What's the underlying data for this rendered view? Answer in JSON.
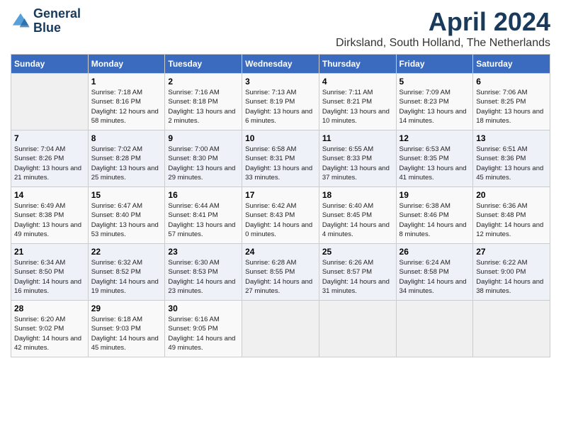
{
  "header": {
    "logo_line1": "General",
    "logo_line2": "Blue",
    "month_year": "April 2024",
    "location": "Dirksland, South Holland, The Netherlands"
  },
  "days_of_week": [
    "Sunday",
    "Monday",
    "Tuesday",
    "Wednesday",
    "Thursday",
    "Friday",
    "Saturday"
  ],
  "weeks": [
    [
      {
        "day": "",
        "sunrise": "",
        "sunset": "",
        "daylight": ""
      },
      {
        "day": "1",
        "sunrise": "Sunrise: 7:18 AM",
        "sunset": "Sunset: 8:16 PM",
        "daylight": "Daylight: 12 hours and 58 minutes."
      },
      {
        "day": "2",
        "sunrise": "Sunrise: 7:16 AM",
        "sunset": "Sunset: 8:18 PM",
        "daylight": "Daylight: 13 hours and 2 minutes."
      },
      {
        "day": "3",
        "sunrise": "Sunrise: 7:13 AM",
        "sunset": "Sunset: 8:19 PM",
        "daylight": "Daylight: 13 hours and 6 minutes."
      },
      {
        "day": "4",
        "sunrise": "Sunrise: 7:11 AM",
        "sunset": "Sunset: 8:21 PM",
        "daylight": "Daylight: 13 hours and 10 minutes."
      },
      {
        "day": "5",
        "sunrise": "Sunrise: 7:09 AM",
        "sunset": "Sunset: 8:23 PM",
        "daylight": "Daylight: 13 hours and 14 minutes."
      },
      {
        "day": "6",
        "sunrise": "Sunrise: 7:06 AM",
        "sunset": "Sunset: 8:25 PM",
        "daylight": "Daylight: 13 hours and 18 minutes."
      }
    ],
    [
      {
        "day": "7",
        "sunrise": "Sunrise: 7:04 AM",
        "sunset": "Sunset: 8:26 PM",
        "daylight": "Daylight: 13 hours and 21 minutes."
      },
      {
        "day": "8",
        "sunrise": "Sunrise: 7:02 AM",
        "sunset": "Sunset: 8:28 PM",
        "daylight": "Daylight: 13 hours and 25 minutes."
      },
      {
        "day": "9",
        "sunrise": "Sunrise: 7:00 AM",
        "sunset": "Sunset: 8:30 PM",
        "daylight": "Daylight: 13 hours and 29 minutes."
      },
      {
        "day": "10",
        "sunrise": "Sunrise: 6:58 AM",
        "sunset": "Sunset: 8:31 PM",
        "daylight": "Daylight: 13 hours and 33 minutes."
      },
      {
        "day": "11",
        "sunrise": "Sunrise: 6:55 AM",
        "sunset": "Sunset: 8:33 PM",
        "daylight": "Daylight: 13 hours and 37 minutes."
      },
      {
        "day": "12",
        "sunrise": "Sunrise: 6:53 AM",
        "sunset": "Sunset: 8:35 PM",
        "daylight": "Daylight: 13 hours and 41 minutes."
      },
      {
        "day": "13",
        "sunrise": "Sunrise: 6:51 AM",
        "sunset": "Sunset: 8:36 PM",
        "daylight": "Daylight: 13 hours and 45 minutes."
      }
    ],
    [
      {
        "day": "14",
        "sunrise": "Sunrise: 6:49 AM",
        "sunset": "Sunset: 8:38 PM",
        "daylight": "Daylight: 13 hours and 49 minutes."
      },
      {
        "day": "15",
        "sunrise": "Sunrise: 6:47 AM",
        "sunset": "Sunset: 8:40 PM",
        "daylight": "Daylight: 13 hours and 53 minutes."
      },
      {
        "day": "16",
        "sunrise": "Sunrise: 6:44 AM",
        "sunset": "Sunset: 8:41 PM",
        "daylight": "Daylight: 13 hours and 57 minutes."
      },
      {
        "day": "17",
        "sunrise": "Sunrise: 6:42 AM",
        "sunset": "Sunset: 8:43 PM",
        "daylight": "Daylight: 14 hours and 0 minutes."
      },
      {
        "day": "18",
        "sunrise": "Sunrise: 6:40 AM",
        "sunset": "Sunset: 8:45 PM",
        "daylight": "Daylight: 14 hours and 4 minutes."
      },
      {
        "day": "19",
        "sunrise": "Sunrise: 6:38 AM",
        "sunset": "Sunset: 8:46 PM",
        "daylight": "Daylight: 14 hours and 8 minutes."
      },
      {
        "day": "20",
        "sunrise": "Sunrise: 6:36 AM",
        "sunset": "Sunset: 8:48 PM",
        "daylight": "Daylight: 14 hours and 12 minutes."
      }
    ],
    [
      {
        "day": "21",
        "sunrise": "Sunrise: 6:34 AM",
        "sunset": "Sunset: 8:50 PM",
        "daylight": "Daylight: 14 hours and 16 minutes."
      },
      {
        "day": "22",
        "sunrise": "Sunrise: 6:32 AM",
        "sunset": "Sunset: 8:52 PM",
        "daylight": "Daylight: 14 hours and 19 minutes."
      },
      {
        "day": "23",
        "sunrise": "Sunrise: 6:30 AM",
        "sunset": "Sunset: 8:53 PM",
        "daylight": "Daylight: 14 hours and 23 minutes."
      },
      {
        "day": "24",
        "sunrise": "Sunrise: 6:28 AM",
        "sunset": "Sunset: 8:55 PM",
        "daylight": "Daylight: 14 hours and 27 minutes."
      },
      {
        "day": "25",
        "sunrise": "Sunrise: 6:26 AM",
        "sunset": "Sunset: 8:57 PM",
        "daylight": "Daylight: 14 hours and 31 minutes."
      },
      {
        "day": "26",
        "sunrise": "Sunrise: 6:24 AM",
        "sunset": "Sunset: 8:58 PM",
        "daylight": "Daylight: 14 hours and 34 minutes."
      },
      {
        "day": "27",
        "sunrise": "Sunrise: 6:22 AM",
        "sunset": "Sunset: 9:00 PM",
        "daylight": "Daylight: 14 hours and 38 minutes."
      }
    ],
    [
      {
        "day": "28",
        "sunrise": "Sunrise: 6:20 AM",
        "sunset": "Sunset: 9:02 PM",
        "daylight": "Daylight: 14 hours and 42 minutes."
      },
      {
        "day": "29",
        "sunrise": "Sunrise: 6:18 AM",
        "sunset": "Sunset: 9:03 PM",
        "daylight": "Daylight: 14 hours and 45 minutes."
      },
      {
        "day": "30",
        "sunrise": "Sunrise: 6:16 AM",
        "sunset": "Sunset: 9:05 PM",
        "daylight": "Daylight: 14 hours and 49 minutes."
      },
      {
        "day": "",
        "sunrise": "",
        "sunset": "",
        "daylight": ""
      },
      {
        "day": "",
        "sunrise": "",
        "sunset": "",
        "daylight": ""
      },
      {
        "day": "",
        "sunrise": "",
        "sunset": "",
        "daylight": ""
      },
      {
        "day": "",
        "sunrise": "",
        "sunset": "",
        "daylight": ""
      }
    ]
  ]
}
